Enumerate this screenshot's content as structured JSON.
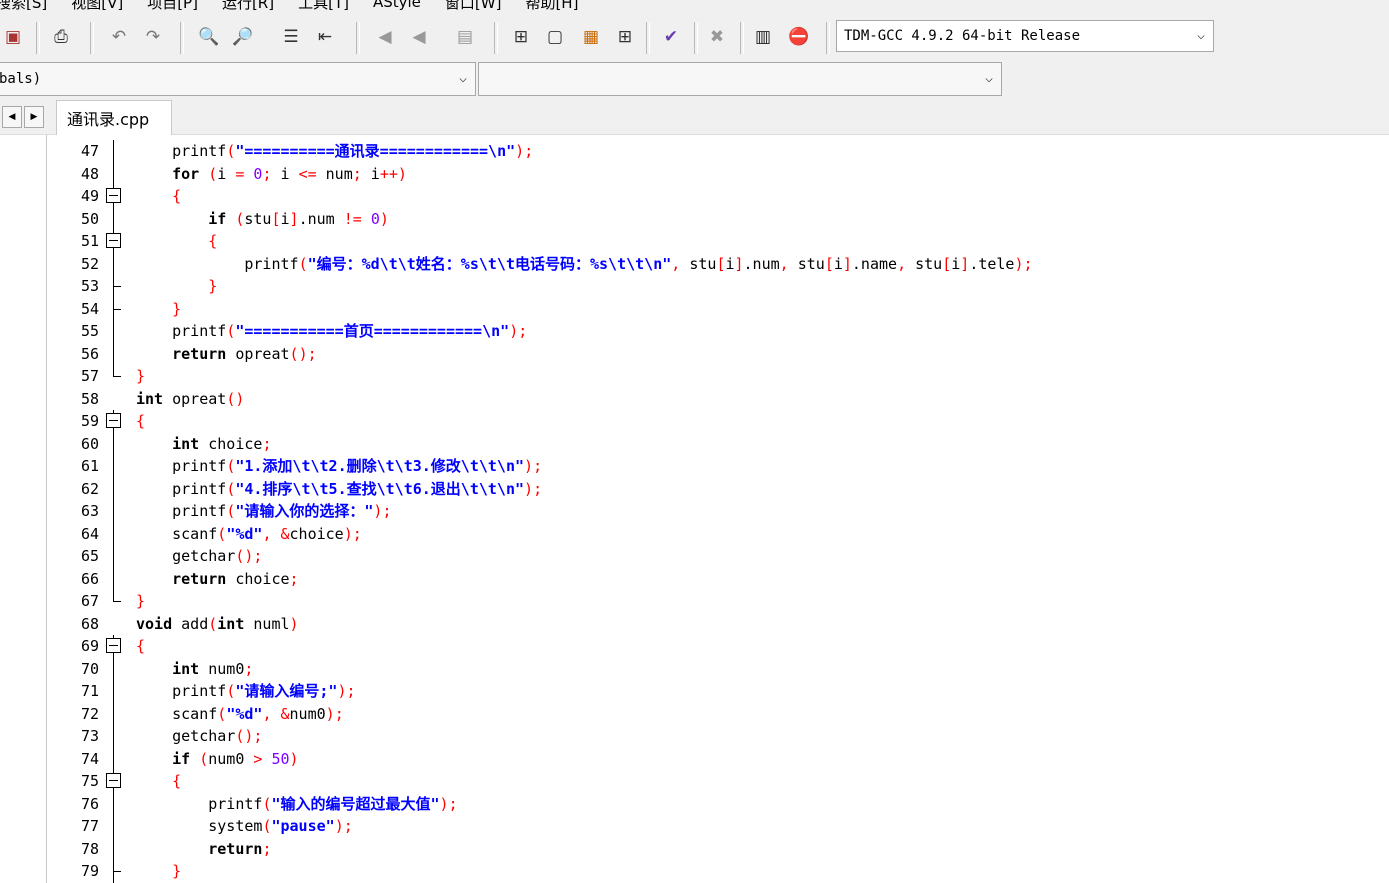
{
  "menu": {
    "items": [
      "搜索[S]",
      "视图[V]",
      "项目[P]",
      "运行[R]",
      "工具[T]",
      "AStyle",
      "窗口[W]",
      "帮助[H]"
    ]
  },
  "toolbar": {
    "compiler": "TDM-GCC 4.9.2 64-bit Release"
  },
  "combos": {
    "class_value": "bals)",
    "member_value": ""
  },
  "tabs": {
    "active": "通讯录.cpp"
  },
  "editor": {
    "lines": [
      {
        "n": "47",
        "fold": "line",
        "code": "    printf(\"==========通讯录============\\n\");"
      },
      {
        "n": "48",
        "fold": "line",
        "code": "    for (i = 0; i <= num; i++)"
      },
      {
        "n": "49",
        "fold": "box",
        "code": "    {"
      },
      {
        "n": "50",
        "fold": "line",
        "code": "        if (stu[i].num != 0)"
      },
      {
        "n": "51",
        "fold": "box",
        "code": "        {"
      },
      {
        "n": "52",
        "fold": "line",
        "code": "            printf(\"编号：%d\\t\\t姓名：%s\\t\\t电话号码：%s\\t\\t\\n\", stu[i].num, stu[i].name, stu[i].tele);"
      },
      {
        "n": "53",
        "fold": "tick",
        "code": "        }"
      },
      {
        "n": "54",
        "fold": "tick",
        "code": "    }"
      },
      {
        "n": "55",
        "fold": "line",
        "code": "    printf(\"===========首页============\\n\");"
      },
      {
        "n": "56",
        "fold": "line",
        "code": "    return opreat();"
      },
      {
        "n": "57",
        "fold": "end",
        "code": "}"
      },
      {
        "n": "58",
        "fold": "none",
        "code": "int opreat()"
      },
      {
        "n": "59",
        "fold": "box",
        "code": "{"
      },
      {
        "n": "60",
        "fold": "line",
        "code": "    int choice;"
      },
      {
        "n": "61",
        "fold": "line",
        "code": "    printf(\"1.添加\\t\\t2.删除\\t\\t3.修改\\t\\t\\n\");"
      },
      {
        "n": "62",
        "fold": "line",
        "code": "    printf(\"4.排序\\t\\t5.查找\\t\\t6.退出\\t\\t\\n\");"
      },
      {
        "n": "63",
        "fold": "line",
        "code": "    printf(\"请输入你的选择：\");"
      },
      {
        "n": "64",
        "fold": "line",
        "code": "    scanf(\"%d\", &choice);"
      },
      {
        "n": "65",
        "fold": "line",
        "code": "    getchar();"
      },
      {
        "n": "66",
        "fold": "line",
        "code": "    return choice;"
      },
      {
        "n": "67",
        "fold": "end",
        "code": "}"
      },
      {
        "n": "68",
        "fold": "none",
        "code": "void add(int numl)"
      },
      {
        "n": "69",
        "fold": "box",
        "code": "{"
      },
      {
        "n": "70",
        "fold": "line",
        "code": "    int num0;"
      },
      {
        "n": "71",
        "fold": "line",
        "code": "    printf(\"请输入编号;\");"
      },
      {
        "n": "72",
        "fold": "line",
        "code": "    scanf(\"%d\", &num0);"
      },
      {
        "n": "73",
        "fold": "line",
        "code": "    getchar();"
      },
      {
        "n": "74",
        "fold": "line",
        "code": "    if (num0 > 50)"
      },
      {
        "n": "75",
        "fold": "box",
        "code": "    {"
      },
      {
        "n": "76",
        "fold": "line",
        "code": "        printf(\"输入的编号超过最大值\");"
      },
      {
        "n": "77",
        "fold": "line",
        "code": "        system(\"pause\");"
      },
      {
        "n": "78",
        "fold": "line",
        "code": "        return;"
      },
      {
        "n": "79",
        "fold": "tick",
        "code": "    }"
      }
    ]
  }
}
